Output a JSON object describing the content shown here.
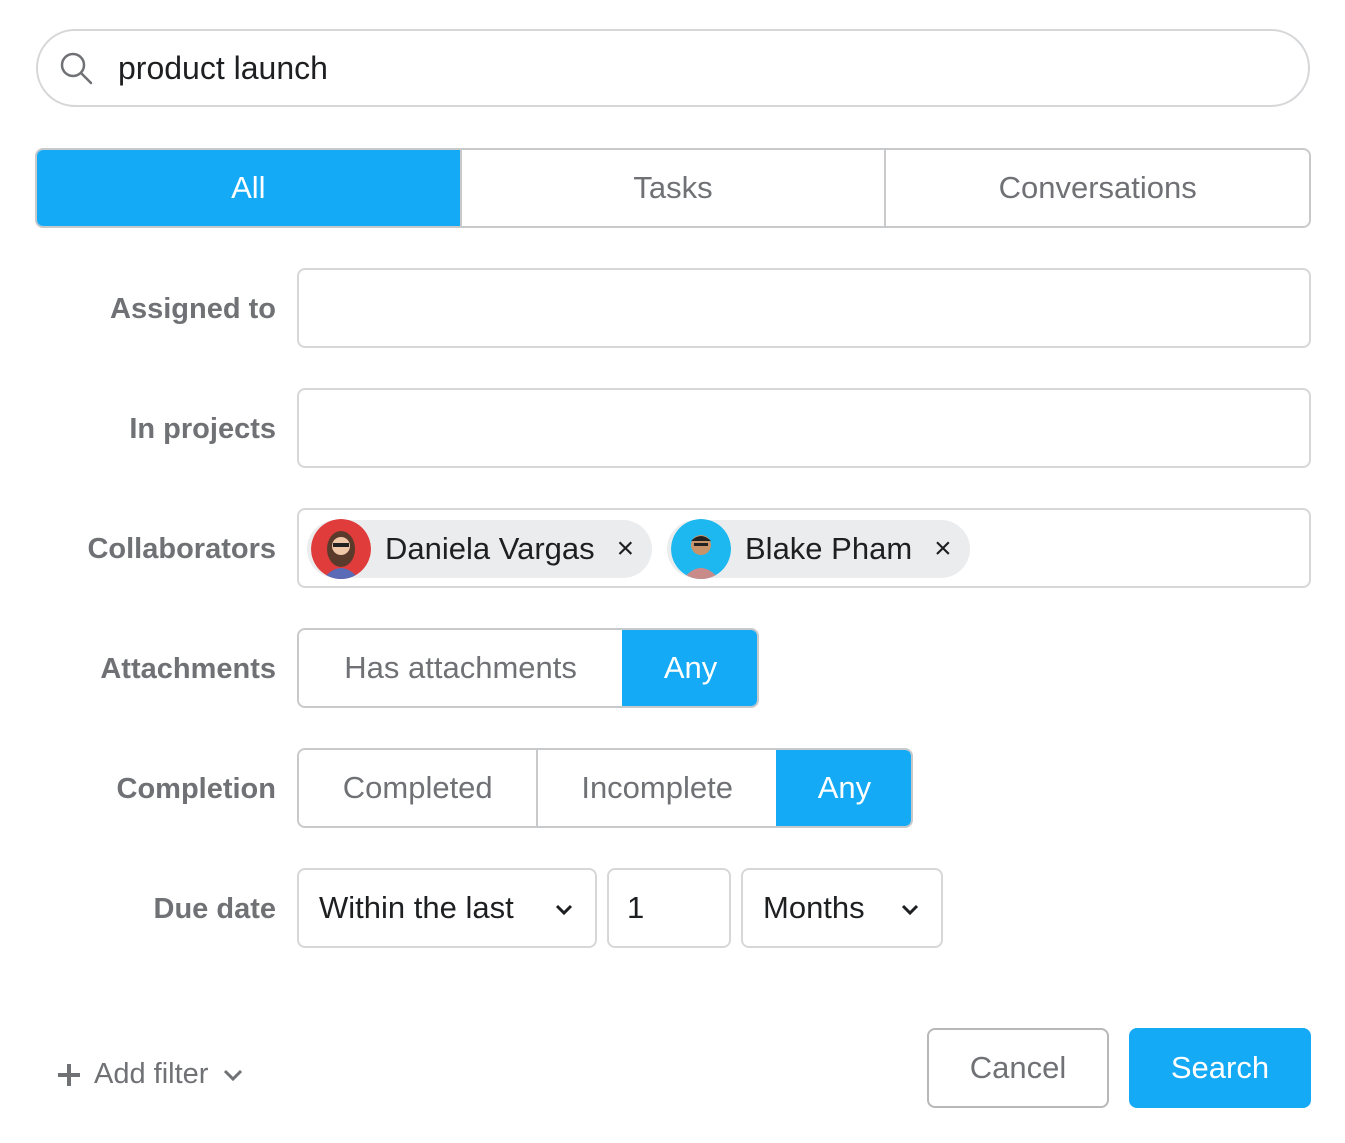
{
  "search": {
    "value": "product launch",
    "icon": "search-icon"
  },
  "tabs": [
    {
      "label": "All",
      "active": true
    },
    {
      "label": "Tasks",
      "active": false
    },
    {
      "label": "Conversations",
      "active": false
    }
  ],
  "filters": {
    "assigned_to": {
      "label": "Assigned to",
      "value": ""
    },
    "in_projects": {
      "label": "In projects",
      "value": ""
    },
    "collaborators": {
      "label": "Collaborators",
      "people": [
        {
          "name": "Daniela Vargas",
          "avatar_bg": "#e03c3c",
          "remove": "×"
        },
        {
          "name": "Blake Pham",
          "avatar_bg": "#1cb8ef",
          "remove": "×"
        }
      ]
    },
    "attachments": {
      "label": "Attachments",
      "options": [
        {
          "label": "Has attachments",
          "active": false
        },
        {
          "label": "Any",
          "active": true
        }
      ]
    },
    "completion": {
      "label": "Completion",
      "options": [
        {
          "label": "Completed",
          "active": false
        },
        {
          "label": "Incomplete",
          "active": false
        },
        {
          "label": "Any",
          "active": true
        }
      ]
    },
    "due_date": {
      "label": "Due date",
      "range": "Within the last",
      "amount": "1",
      "unit": "Months"
    }
  },
  "footer": {
    "add_filter": "Add filter",
    "cancel": "Cancel",
    "search": "Search"
  },
  "colors": {
    "accent": "#14aaf5",
    "label": "#6f7175",
    "border": "#d6d7d9"
  }
}
